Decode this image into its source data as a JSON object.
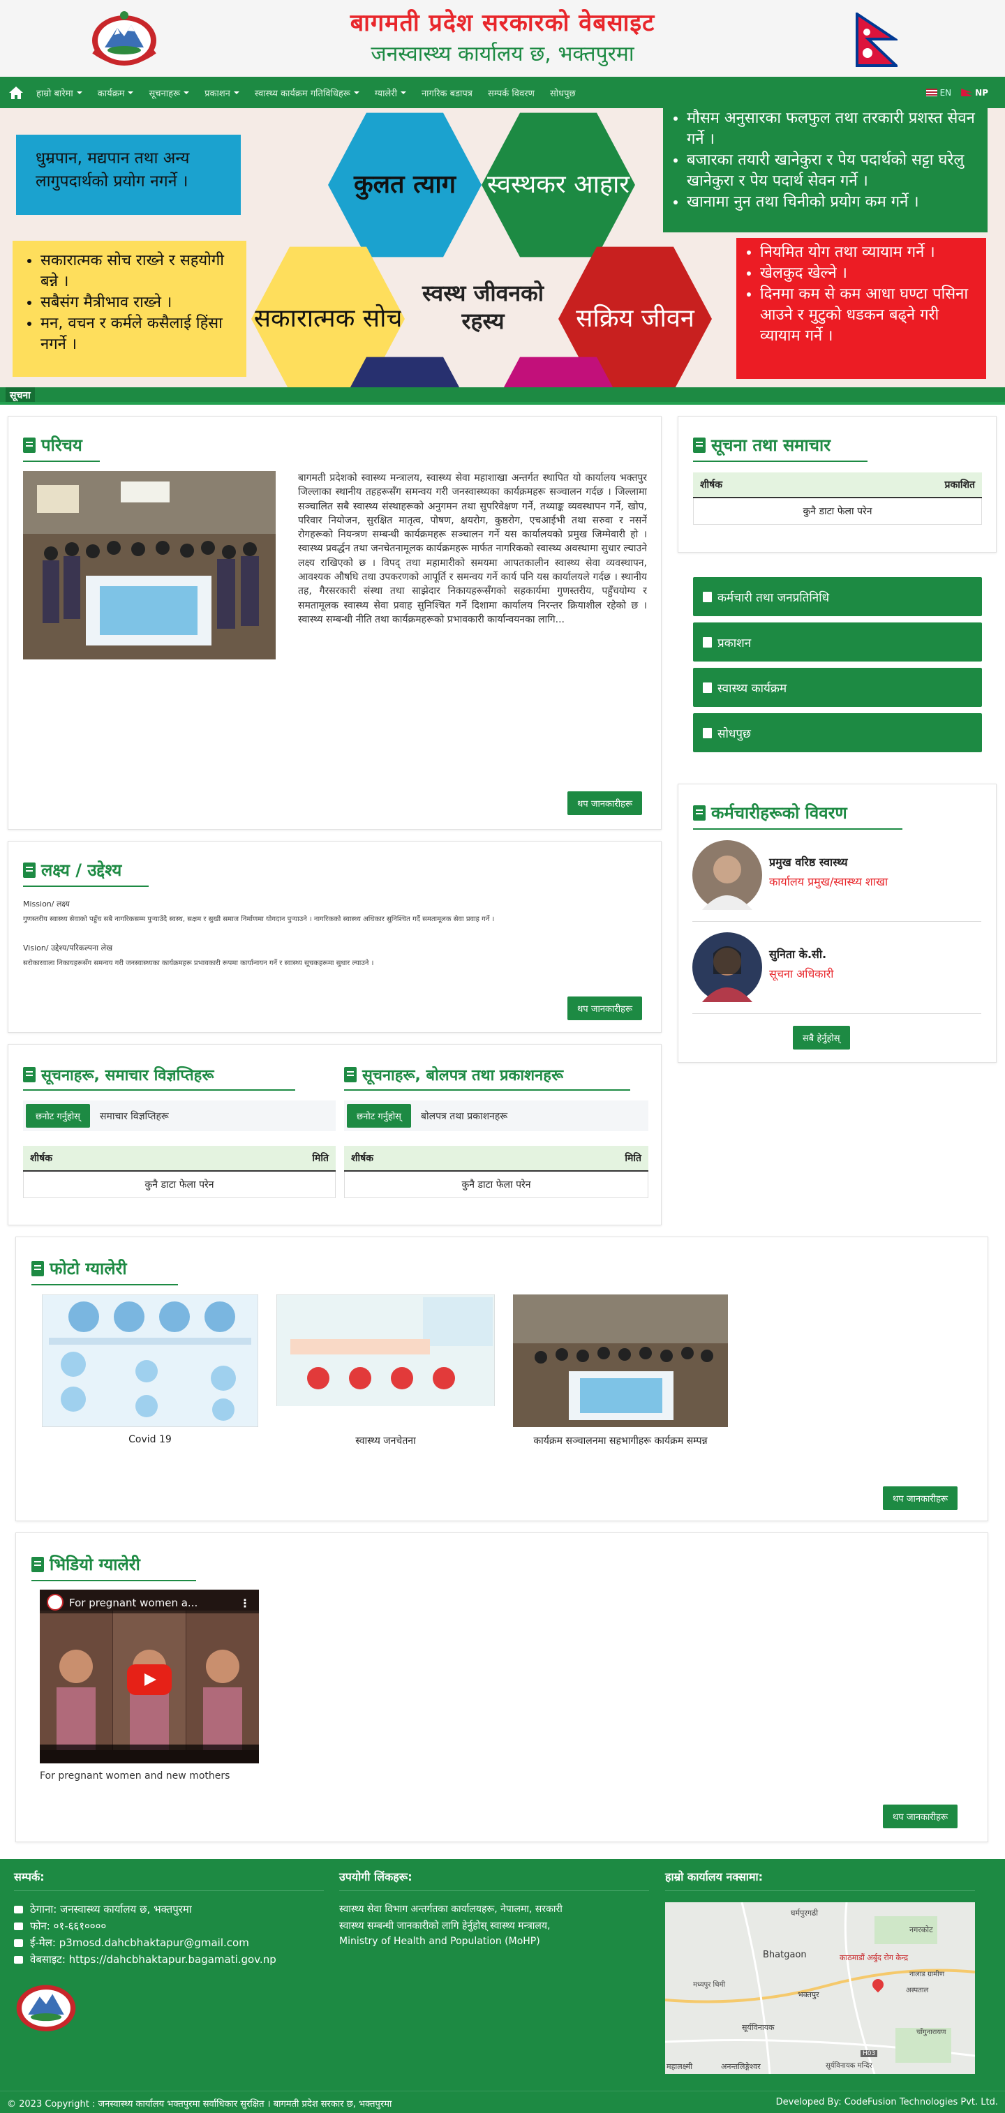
{
  "header": {
    "title_line1": "बागमती प्रदेश सरकारको वेबसाइट",
    "title_line2": "जनस्वास्थ्य कार्यालय छ, भक्तपुरमा"
  },
  "nav": {
    "items": [
      {
        "label": "हाम्रो बारेमा",
        "dropdown": true
      },
      {
        "label": "कार्यक्रम",
        "dropdown": true
      },
      {
        "label": "सूचनाहरू",
        "dropdown": true
      },
      {
        "label": "प्रकाशन",
        "dropdown": true
      },
      {
        "label": "स्वास्थ्य कार्यक्रम गतिविधिहरू",
        "dropdown": true
      },
      {
        "label": "ग्यालेरी",
        "dropdown": true
      },
      {
        "label": "नागरिक बडापत्र",
        "dropdown": false
      },
      {
        "label": "सम्पर्क विवरण",
        "dropdown": false
      },
      {
        "label": "सोधपुछ",
        "dropdown": false
      }
    ],
    "lang_en": "EN",
    "lang_np": "NP"
  },
  "hero": {
    "box_tl": "धुम्रपान, मद्यपान तथा अन्य लागुपदार्थको प्रयोग नगर्ने ।",
    "box_bl": [
      "सकारात्मक सोच राख्ने र सहयोगी बन्ने ।",
      "सबैसंग मैत्रीभाव राख्ने ।",
      "मन, वचन र कर्मले कसैलाई हिंसा नगर्ने ।"
    ],
    "hex_kulat": "कुलत त्याग",
    "hex_swasthakar": "स्वस्थकर आहार",
    "hex_sakaratmak": "सकारात्मक सोच",
    "center_text": "स्वस्थ जीवनको रहस्य",
    "hex_sakriya": "सक्रिय जीवन",
    "box_tr": [
      "मौसम अनुसारका फलफुल तथा तरकारी प्रशस्त सेवन गर्ने ।",
      "बजारका तयारी खानेकुरा र पेय पदार्थको सट्टा घरेलु खानेकुरा र पेय पदार्थ सेवन गर्ने ।",
      "खानामा नुन तथा चिनीको प्रयोग कम गर्ने ।"
    ],
    "box_br": [
      "नियमित योग तथा व्यायाम गर्ने ।",
      "खेलकुद खेल्ने ।",
      "दिनमा कम से कम आधा घण्टा पसिना आउने र मुटुको धडकन बढ्ने गरी व्यायाम गर्ने ।"
    ]
  },
  "ticker": {
    "label": "सूचना"
  },
  "about": {
    "title": "परिचय",
    "body": "बागमती प्रदेशको स्वास्थ्य मन्त्रालय, स्वास्थ्य सेवा महाशाखा अन्तर्गत स्थापित यो कार्यालय भक्तपुर जिल्लाका स्थानीय तहहरूसँग समन्वय गरी जनस्वास्थ्यका कार्यक्रमहरू सञ्चालन गर्दछ । जिल्लामा सञ्चालित सबै स्वास्थ्य संस्थाहरूको अनुगमन तथा सुपरिवेक्षण गर्ने, तथ्याङ्क व्यवस्थापन गर्ने, खोप, परिवार नियोजन, सुरक्षित मातृत्व, पोषण, क्षयरोग, कुष्ठरोग, एचआईभी तथा सरुवा र नसर्ने रोगहरूको नियन्त्रण सम्बन्धी कार्यक्रमहरू सञ्चालन गर्ने यस कार्यालयको प्रमुख जिम्मेवारी हो । स्वास्थ्य प्रवर्द्धन तथा जनचेतनामूलक कार्यक्रमहरू मार्फत नागरिकको स्वास्थ्य अवस्थामा सुधार ल्याउने लक्ष्य राखिएको छ । विपद् तथा महामारीको समयमा आपतकालीन स्वास्थ्य सेवा व्यवस्थापन, आवश्यक औषधि तथा उपकरणको आपूर्ति र समन्वय गर्ने कार्य पनि यस कार्यालयले गर्दछ । स्थानीय तह, गैरसरकारी संस्था तथा साझेदार निकायहरूसँगको सहकार्यमा गुणस्तरीय, पहुँचयोग्य र समतामूलक स्वास्थ्य सेवा प्रवाह सुनिश्चित गर्ने दिशामा कार्यालय निरन्तर क्रियाशील रहेको छ । स्वास्थ्य सम्बन्धी नीति तथा कार्यक्रमहरूको प्रभावकारी कार्यान्वयनका लागि...",
    "more": "थप जानकारीहरू"
  },
  "mission": {
    "title": "लक्ष्य / उद्देश्य",
    "mission_label": "Mission/ लक्ष्य",
    "mission_text": "गुणस्तरीय स्वास्थ्य सेवाको पहुँच सबै नागरिकसम्म पुर्‍याउँदै स्वस्थ, सक्षम र सुखी समाज निर्माणमा योगदान पुर्‍याउने । नागरिकको स्वास्थ्य अधिकार सुनिश्चित गर्दै समतामूलक सेवा प्रवाह गर्ने ।",
    "vision_label": "Vision/ उद्देश्य/परिकल्पना लेख",
    "vision_text": "सरोकारवाला निकायहरूसँग समन्वय गरी जनस्वास्थ्यका कार्यक्रमहरू प्रभावकारी रूपमा कार्यान्वयन गर्ने र स्वास्थ्य सूचकहरूमा सुधार ल्याउने ।",
    "more": "थप जानकारीहरू"
  },
  "latest_news": {
    "title": "सूचनाहरू, समाचार विज्ञप्तिहरू",
    "filter_btn": "छनोट गर्नुहोस्",
    "filter_text": "समाचार विज्ञप्तिहरू",
    "col1": "शीर्षक",
    "col2": "मिति",
    "empty": "कुनै डाटा फेला परेन"
  },
  "downloads": {
    "title": "सूचनाहरू, बोलपत्र तथा प्रकाशनहरू",
    "filter_btn": "छनोट गर्नुहोस्",
    "filter_text": "बोलपत्र तथा प्रकाशनहरू",
    "col1": "शीर्षक",
    "col2": "मिति",
    "empty": "कुनै डाटा फेला परेन"
  },
  "side_notice": {
    "title": "सूचना तथा समाचार",
    "col1": "शीर्षक",
    "col2": "प्रकाशित",
    "empty": "कुनै डाटा फेला परेन"
  },
  "side_links": [
    "कर्मचारी तथा जनप्रतिनिधि",
    "प्रकाशन",
    "स्वास्थ्य कार्यक्रम",
    "सोधपुछ"
  ],
  "staff": {
    "title": "कर्मचारीहरूको विवरण",
    "p1_name": "प्रमुख वरिष्ठ स्वास्थ्य",
    "p1_role": "कार्यालय प्रमुख/स्वास्थ्य शाखा",
    "p2_name": "सुनिता के.सी.",
    "p2_role": "सूचना अधिकारी",
    "more": "सबै हेर्नुहोस्"
  },
  "gallery": {
    "title": "फोटो ग्यालेरी",
    "items": [
      "Covid 19",
      "स्वास्थ्य जनचेतना",
      "कार्यक्रम सञ्चालनमा सहभागीहरू कार्यक्रम सम्पन्न"
    ],
    "more": "थप जानकारीहरू"
  },
  "video": {
    "title": "भिडियो ग्यालेरी",
    "video_title": "For pregnant women a...",
    "caption": "For pregnant women and new mothers",
    "more": "थप जानकारीहरू"
  },
  "footer": {
    "contact_title": "सम्पर्क:",
    "contact_address": "ठेगाना: जनस्वास्थ्य कार्यालय छ, भक्तपुरमा",
    "contact_phone": "फोन: ०१-६६१००००",
    "contact_email": "ई-मेल: p3mosd.dahcbhaktapur@gmail.com",
    "contact_web": "वेबसाइट: https://dahcbhaktapur.bagamati.gov.np",
    "links_title": "उपयोगी लिंकहरू:",
    "links_text1": "स्वास्थ्य सेवा विभाग अन्तर्गतका कार्यालयहरू, नेपालमा, सरकारी",
    "links_text2": "स्वास्थ्य सम्बन्धी जानकारीको लागि हेर्नुहोस् स्वास्थ्य मन्त्रालय,",
    "links_text3": "Ministry of Health and Population (MoHP)",
    "map_title": "हाम्रो कार्यालय नक्सामा:",
    "map_labels": [
      "घर्मपुरगढी",
      "नगरकोट",
      "Bhatgaon",
      "काठमाडौं अर्बुद रोग केन्द्र",
      "भक्तपुर",
      "सूर्यविनायक",
      "चाँगुनारायण",
      "महालक्ष्मी",
      "अनन्तलिङ्गेश्वर",
      "अस्पताल",
      "मध्यपुर थिमी",
      "सूर्यविनायक मन्दिर",
      "नालाड ग्रामीण",
      "H03"
    ],
    "copyright": "© 2023 Copyright : जनस्वास्थ्य कार्यालय भक्तपुरमा सर्वाधिकार सुरक्षित । बागमती प्रदेश सरकार छ, भक्तपुरमा",
    "developer": "Developed By: CodeFusion Technologies Pvt. Ltd."
  }
}
